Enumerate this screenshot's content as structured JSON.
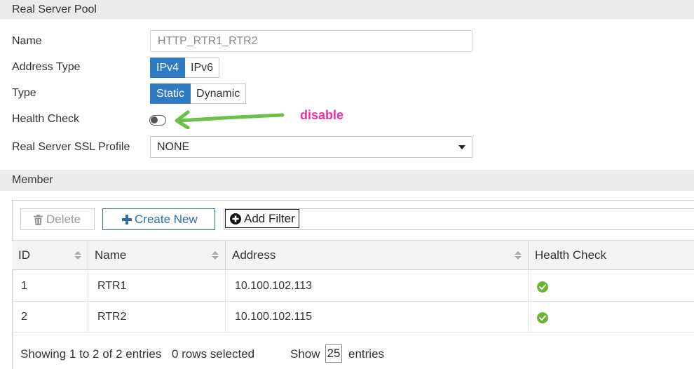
{
  "pool": {
    "section_title": "Real Server Pool",
    "name_label": "Name",
    "name_value": "HTTP_RTR1_RTR2",
    "address_type_label": "Address Type",
    "address_type_options": [
      "IPv4",
      "IPv6"
    ],
    "address_type_selected": "IPv4",
    "type_label": "Type",
    "type_options": [
      "Static",
      "Dynamic"
    ],
    "type_selected": "Static",
    "health_check_label": "Health Check",
    "health_check_enabled": false,
    "ssl_profile_label": "Real Server SSL Profile",
    "ssl_profile_value": "NONE"
  },
  "annotation": {
    "text": "disable",
    "color": "#ee2fa4",
    "arrow_color": "#6cc04a"
  },
  "member": {
    "section_title": "Member",
    "toolbar": {
      "delete_label": "Delete",
      "create_label": "Create New",
      "filter_label": "Add Filter"
    },
    "columns": [
      "ID",
      "Name",
      "Address",
      "Health Check"
    ],
    "rows": [
      {
        "id": "1",
        "name": "RTR1",
        "address": "10.100.102.113",
        "health": "ok"
      },
      {
        "id": "2",
        "name": "RTR2",
        "address": "10.100.102.115",
        "health": "ok"
      }
    ],
    "footer": {
      "showing": "Showing 1 to 2 of 2 entries",
      "selected": "0 rows selected",
      "show_label": "Show",
      "page_size": "25",
      "entries_label": "entries"
    }
  },
  "colors": {
    "accent": "#2f7ac0",
    "status_ok": "#69b32d"
  }
}
